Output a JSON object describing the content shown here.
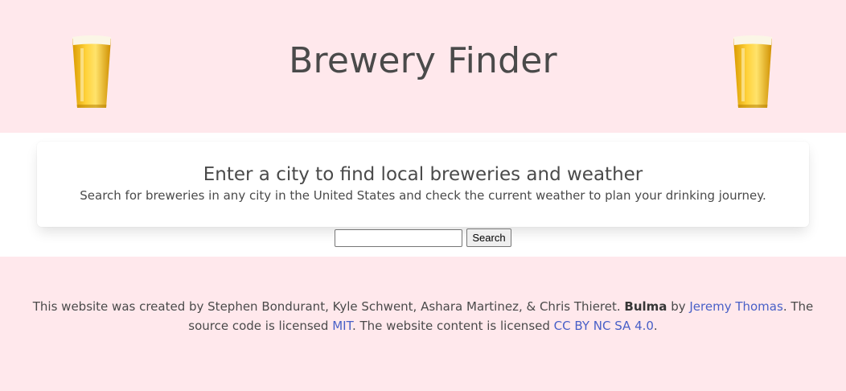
{
  "header": {
    "title": "Brewery Finder",
    "left_icon": "beer-glass-icon",
    "right_icon": "beer-glass-icon"
  },
  "card": {
    "title": "Enter a city to find local breweries and weather",
    "subtitle": "Search for breweries in any city in the United States and check the current weather to plan your drinking journey."
  },
  "search": {
    "value": "",
    "placeholder": "",
    "button_label": "Search"
  },
  "footer": {
    "text1": "This website was created by Stephen Bondurant, Kyle Schwent, Ashara Martinez, & Chris Thieret. ",
    "brand": "Bulma",
    "by": " by ",
    "author_link": "Jeremy Thomas",
    "text2": ". The source code is licensed ",
    "license_link": "MIT",
    "text3": ". The website content is licensed ",
    "content_license_link": "CC BY NC SA 4.0",
    "text4": "."
  },
  "colors": {
    "background_pink": "#ffe8ec",
    "text": "#4a4a4a",
    "link": "#485fc7"
  }
}
